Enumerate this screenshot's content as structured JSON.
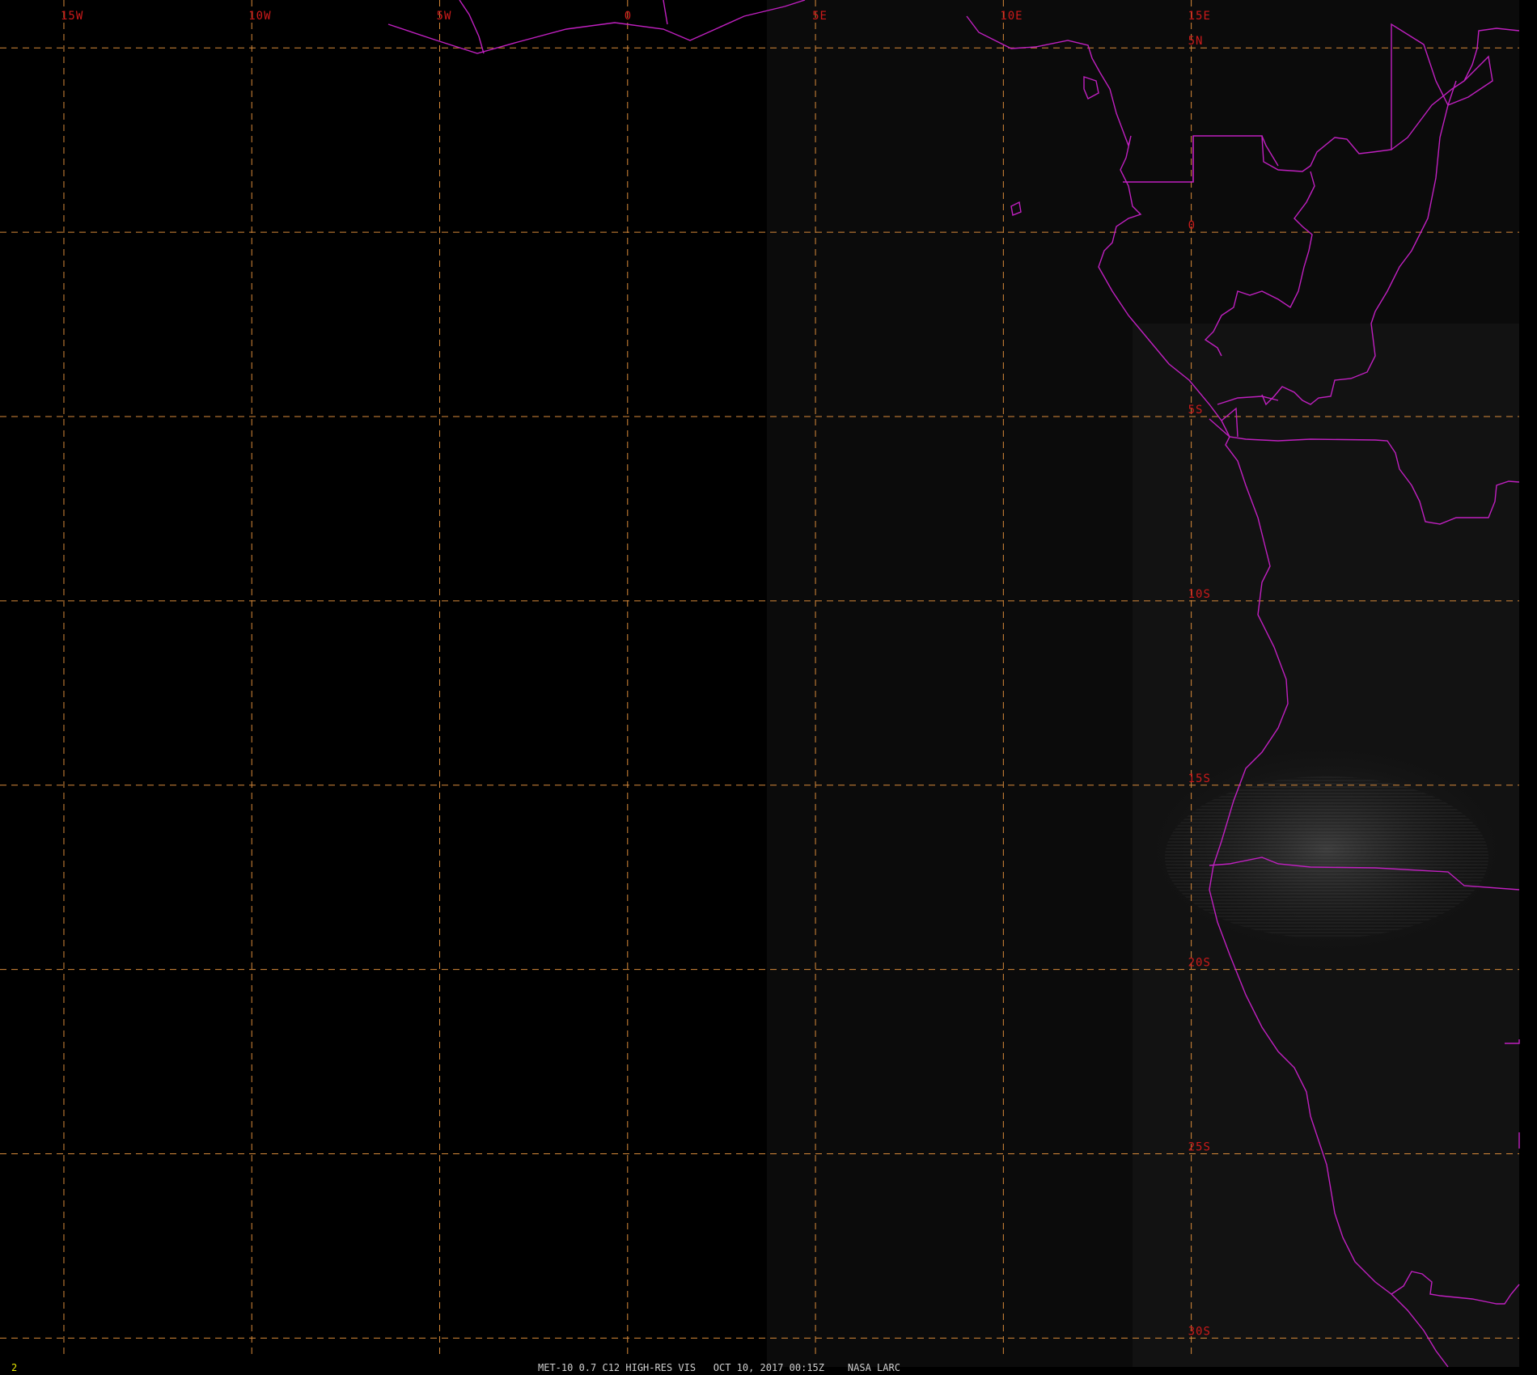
{
  "colors": {
    "background": "#000000",
    "grid": "#d88a3a",
    "grid_label": "#cc1a1a",
    "coastline": "#c020c0",
    "frame_number": "#e8e800",
    "caption": "#cfcfcf"
  },
  "map": {
    "projection": "lat-lon",
    "lon_range": [
      -16.7,
      24.2
    ],
    "lat_range": [
      6.3,
      -31.0
    ],
    "meridian_labels": [
      "15W",
      "10W",
      "5W",
      "0",
      "5E",
      "10E",
      "15E"
    ],
    "parallel_labels": [
      "5N",
      "0",
      "5S",
      "10S",
      "15S",
      "20S",
      "25S",
      "30S"
    ]
  },
  "status_bar": {
    "frame_number": "2",
    "caption": "MET-10 0.7 C12 HIGH-RES VIS   OCT 10, 2017 00:15Z    NASA LARC"
  }
}
